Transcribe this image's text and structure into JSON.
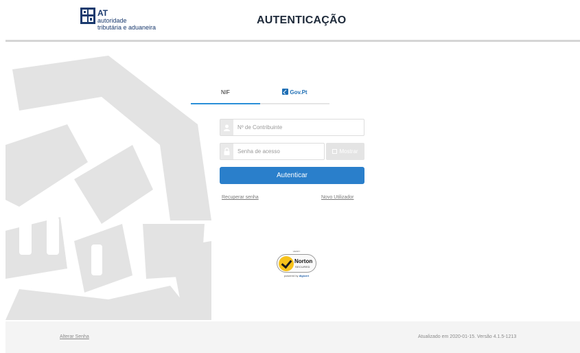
{
  "header": {
    "logo": {
      "abbrev": "AT",
      "line1": "autoridade",
      "line2": "tributária e aduaneira"
    },
    "title": "AUTENTICAÇÃO"
  },
  "tabs": [
    {
      "label": "NIF",
      "active": true
    },
    {
      "label": "Gov.Pt",
      "active": false
    }
  ],
  "form": {
    "nif_placeholder": "Nº de Contribuinte",
    "nif_value": "",
    "password_placeholder": "Senha de acesso",
    "password_value": "",
    "show_label": "Mostrar",
    "submit_label": "Autenticar",
    "recover_link": "Recuperar senha",
    "new_user_link": "Novo Utilizador"
  },
  "seal": {
    "verify": "VERIFY",
    "name": "Norton",
    "secured": "SECURED",
    "powered_by": "powered by",
    "provider": "digicert"
  },
  "footer": {
    "change_password_link": "Alterar Senha",
    "version_text": "Atualizado em 2020-01-15. Versão 4.1.5-1213"
  },
  "colors": {
    "accent": "#2a7fcb",
    "tab_underline": "#2a8fd8",
    "brand_blue": "#1a3a6e",
    "emblem_gray": "#e3e3e3"
  },
  "icons": {
    "nif_field": "user-icon",
    "password_field": "lock-icon",
    "gov_tab": "govpt-badge-icon",
    "seal": "norton-check-icon"
  }
}
